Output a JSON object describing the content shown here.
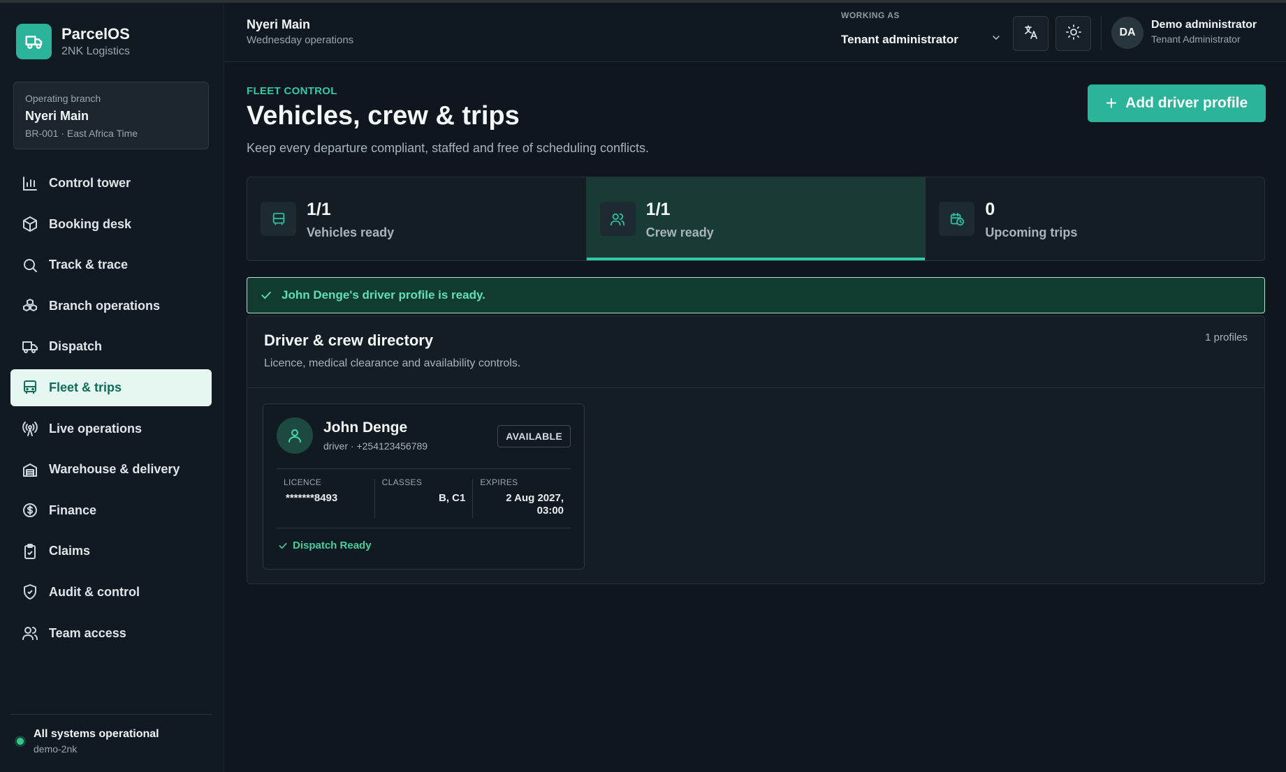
{
  "brand": {
    "name": "ParcelOS",
    "subtitle": "2NK Logistics"
  },
  "branch": {
    "label": "Operating branch",
    "name": "Nyeri Main",
    "meta": "BR-001 · East Africa Time"
  },
  "nav": [
    {
      "label": "Control tower",
      "icon": "chart-bar-icon"
    },
    {
      "label": "Booking desk",
      "icon": "package-icon"
    },
    {
      "label": "Track & trace",
      "icon": "search-icon"
    },
    {
      "label": "Branch operations",
      "icon": "boxes-icon"
    },
    {
      "label": "Dispatch",
      "icon": "truck-icon"
    },
    {
      "label": "Fleet & trips",
      "icon": "bus-icon",
      "active": true
    },
    {
      "label": "Live operations",
      "icon": "radio-tower-icon"
    },
    {
      "label": "Warehouse & delivery",
      "icon": "warehouse-icon"
    },
    {
      "label": "Finance",
      "icon": "dollar-circle-icon"
    },
    {
      "label": "Claims",
      "icon": "clipboard-check-icon"
    },
    {
      "label": "Audit & control",
      "icon": "shield-check-icon"
    },
    {
      "label": "Team access",
      "icon": "users-icon"
    }
  ],
  "system": {
    "title": "All systems operational",
    "sub": "demo-2nk"
  },
  "header": {
    "title": "Nyeri Main",
    "subtitle": "Wednesday operations",
    "working_label": "WORKING AS",
    "working_value": "Tenant administrator",
    "user_initials": "DA",
    "user_name": "Demo administrator",
    "user_role": "Tenant Administrator"
  },
  "page": {
    "eyebrow": "FLEET CONTROL",
    "title": "Vehicles, crew & trips",
    "description": "Keep every departure compliant, staffed and free of scheduling conflicts.",
    "add_button": "Add driver profile"
  },
  "stats": [
    {
      "value": "1/1",
      "label": "Vehicles ready",
      "icon": "bus-icon"
    },
    {
      "value": "1/1",
      "label": "Crew ready",
      "icon": "users-icon",
      "active": true
    },
    {
      "value": "0",
      "label": "Upcoming trips",
      "icon": "calendar-clock-icon"
    }
  ],
  "alert": {
    "message": "John Denge's driver profile is ready."
  },
  "directory": {
    "title": "Driver & crew directory",
    "subtitle": "Licence, medical clearance and availability controls.",
    "count": "1 profiles"
  },
  "driver": {
    "name": "John Denge",
    "meta": "driver · +254123456789",
    "status": "AVAILABLE",
    "licence_label": "LICENCE",
    "licence_value": "*******8493",
    "classes_label": "CLASSES",
    "classes_value": "B, C1",
    "expires_label": "EXPIRES",
    "expires_value": "2 Aug 2027, 03:00",
    "footer": "Dispatch Ready"
  },
  "colors": {
    "accent": "#2bb49a",
    "success": "#43cf9d",
    "bg": "#0f161d"
  }
}
